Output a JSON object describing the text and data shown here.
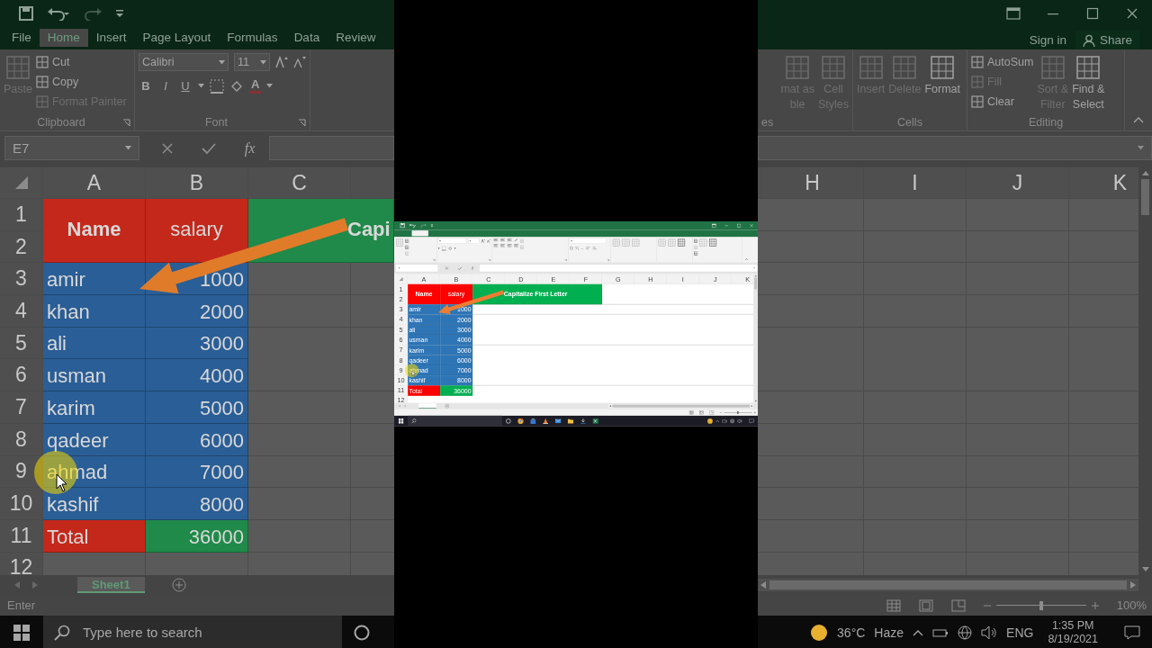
{
  "background_left": {
    "tabs": [
      {
        "label": "File",
        "selected": false
      },
      {
        "label": "Home",
        "selected": true
      },
      {
        "label": "Insert",
        "selected": false
      },
      {
        "label": "Page Layout",
        "selected": false
      },
      {
        "label": "Formulas",
        "selected": false
      },
      {
        "label": "Data",
        "selected": false
      },
      {
        "label": "Review",
        "selected": false
      }
    ],
    "ribbon": [
      {
        "kind": "clipboard",
        "label": "Clipboard",
        "buttons": [
          {
            "kind": "large",
            "lines": [
              "Paste"
            ],
            "disabled": true
          },
          {
            "kind": "small",
            "lines": [
              "Cut"
            ],
            "disabled": false
          },
          {
            "kind": "small",
            "lines": [
              "Copy"
            ],
            "disabled": false
          },
          {
            "kind": "small",
            "lines": [
              "Format Painter"
            ],
            "disabled": true
          }
        ]
      },
      {
        "kind": "font",
        "label": "Font",
        "font_name": "Calibri",
        "font_size": "11",
        "bold": "B",
        "italic": "I",
        "underline": "U",
        "font_color": "A"
      }
    ],
    "name_box": "E7",
    "insert_function": "fx",
    "sheet": {
      "columns": [
        "A",
        "B",
        "C"
      ],
      "rows": [
        "1",
        "2",
        "3",
        "4",
        "5",
        "6",
        "7",
        "8",
        "9",
        "10",
        "11",
        "12"
      ],
      "header": {
        "name": "Name",
        "salary": "salary",
        "note": "Capi"
      },
      "records": [
        {
          "name": "amir",
          "salary": "1000"
        },
        {
          "name": "khan",
          "salary": "2000"
        },
        {
          "name": "ali",
          "salary": "3000"
        },
        {
          "name": "usman",
          "salary": "4000"
        },
        {
          "name": "karim",
          "salary": "5000"
        },
        {
          "name": "qadeer",
          "salary": "6000"
        },
        {
          "name": "ahmad",
          "salary": "7000"
        },
        {
          "name": "kashif",
          "salary": "8000"
        }
      ],
      "total": {
        "label": "Total",
        "value": "36000"
      }
    },
    "sheet_tabs": [
      {
        "label": "Sheet1",
        "selected": true
      }
    ],
    "status": "Enter",
    "taskbar": {
      "search_placeholder": "Type here to search"
    }
  },
  "video": {
    "tabs": [
      {
        "selected": false
      },
      {
        "selected": true
      },
      {
        "selected": false
      },
      {
        "selected": false
      },
      {
        "selected": false
      },
      {
        "selected": false
      },
      {
        "selected": false
      },
      {
        "selected": false
      },
      {
        "selected": false
      }
    ],
    "ribbon": [
      {
        "kind": "clipboard",
        "buttons": [
          {
            "kind": "large",
            "disabled": true
          },
          {
            "kind": "small",
            "disabled": false
          },
          {
            "kind": "small",
            "disabled": false
          },
          {
            "kind": "small",
            "disabled": true
          }
        ]
      },
      {
        "kind": "font"
      },
      {
        "kind": "alignment",
        "buttons": [
          {
            "kind": "small",
            "disabled": true
          },
          {
            "kind": "small",
            "disabled": true
          }
        ]
      },
      {
        "kind": "number"
      },
      {
        "kind": "styles",
        "buttons": [
          {
            "kind": "large",
            "disabled": true
          },
          {
            "kind": "large",
            "disabled": true
          },
          {
            "kind": "large",
            "disabled": true
          }
        ]
      },
      {
        "kind": "cells",
        "buttons": [
          {
            "kind": "large",
            "disabled": true
          },
          {
            "kind": "large",
            "disabled": true
          },
          {
            "kind": "large",
            "disabled": false
          }
        ]
      },
      {
        "kind": "editing",
        "buttons": [
          {
            "kind": "small",
            "disabled": false
          },
          {
            "kind": "small",
            "disabled": true
          },
          {
            "kind": "small",
            "disabled": false
          },
          {
            "kind": "large",
            "disabled": true
          },
          {
            "kind": "large",
            "disabled": false
          }
        ]
      }
    ],
    "sheet": {
      "columns": [
        "A",
        "B",
        "C",
        "D",
        "E",
        "F",
        "G",
        "H",
        "I",
        "J",
        "K"
      ],
      "rows": [
        "1",
        "2",
        "3",
        "4",
        "5",
        "6",
        "7",
        "8",
        "9",
        "10",
        "11",
        "12"
      ],
      "header": {
        "name": "Name",
        "salary": "salary",
        "note": "Capitalize First Letter"
      },
      "records": [
        {
          "name": "amir",
          "salary": "1000"
        },
        {
          "name": "khan",
          "salary": "2000"
        },
        {
          "name": "ali",
          "salary": "3000"
        },
        {
          "name": "usman",
          "salary": "4000"
        },
        {
          "name": "karim",
          "salary": "5000"
        },
        {
          "name": "qadeer",
          "salary": "6000"
        },
        {
          "name": "ahmad",
          "salary": "7000"
        },
        {
          "name": "kashif",
          "salary": "8000"
        }
      ],
      "total": {
        "label": "Total",
        "value": "36000"
      }
    },
    "sheet_tabs": [
      {
        "selected": true
      }
    ],
    "zoom_slider": {
      "level": 0.5
    }
  },
  "background_right": {
    "account": {
      "sign_in": "Sign in",
      "share": "Share"
    },
    "ribbon": [
      {
        "kind": "styles",
        "label": "es",
        "buttons": [
          {
            "kind": "large",
            "lines": [
              "mat as",
              "ble"
            ],
            "disabled": true
          },
          {
            "kind": "large",
            "lines": [
              "Cell",
              "Styles"
            ],
            "disabled": true
          }
        ]
      },
      {
        "kind": "cells",
        "label": "Cells",
        "buttons": [
          {
            "kind": "large",
            "lines": [
              "Insert"
            ],
            "disabled": true
          },
          {
            "kind": "large",
            "lines": [
              "Delete"
            ],
            "disabled": true
          },
          {
            "kind": "large",
            "lines": [
              "Format"
            ],
            "disabled": false
          }
        ]
      },
      {
        "kind": "editing",
        "label": "Editing",
        "buttons": [
          {
            "kind": "small",
            "lines": [
              "AutoSum"
            ],
            "disabled": false
          },
          {
            "kind": "small",
            "lines": [
              "Fill"
            ],
            "disabled": true
          },
          {
            "kind": "small",
            "lines": [
              "Clear"
            ],
            "disabled": false
          },
          {
            "kind": "large",
            "lines": [
              "Sort &",
              "Filter"
            ],
            "disabled": true
          },
          {
            "kind": "large",
            "lines": [
              "Find &",
              "Select"
            ],
            "disabled": false
          }
        ]
      }
    ],
    "sheet": {
      "columns": [
        "H",
        "I",
        "J",
        "K"
      ]
    },
    "zoom_slider": {
      "level": 0.5
    },
    "zoom": "100%",
    "taskbar": {
      "temperature": "36°C",
      "weather": "Haze",
      "language": "ENG",
      "time": "1:35 PM",
      "date": "8/19/2021"
    }
  }
}
